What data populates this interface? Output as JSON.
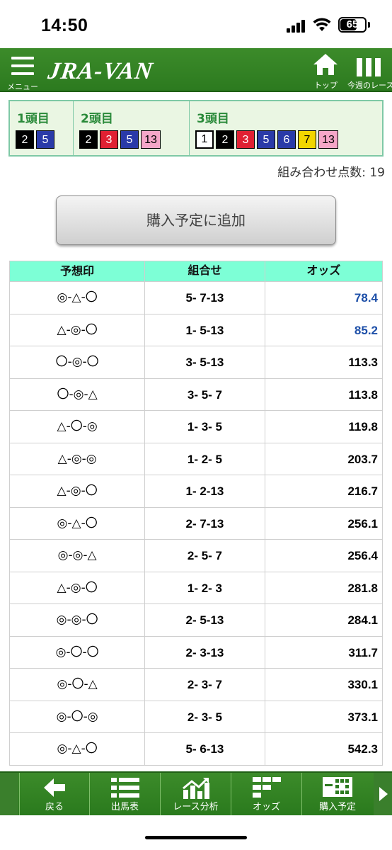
{
  "status": {
    "time": "14:50",
    "battery": "65"
  },
  "header": {
    "menu_label": "メニュー",
    "logo": "JRA-VAN",
    "top_label": "トップ",
    "week_label": "今週のレース"
  },
  "selection": {
    "cols": [
      {
        "title": "1頭目",
        "nums": [
          "2",
          "5"
        ]
      },
      {
        "title": "2頭目",
        "nums": [
          "2",
          "3",
          "5",
          "13"
        ]
      },
      {
        "title": "3頭目",
        "nums": [
          "1",
          "2",
          "3",
          "5",
          "6",
          "7",
          "13"
        ]
      }
    ]
  },
  "combo_count": "組み合わせ点数: 19",
  "add_button": "購入予定に追加",
  "table": {
    "headers": [
      "予想印",
      "組合せ",
      "オッズ"
    ],
    "rows": [
      {
        "mark": "◎-△-〇",
        "combo": "5- 7-13",
        "odds": "78.4"
      },
      {
        "mark": "△-◎-〇",
        "combo": "1- 5-13",
        "odds": "85.2"
      },
      {
        "mark": "〇-◎-〇",
        "combo": "3- 5-13",
        "odds": "113.3"
      },
      {
        "mark": "〇-◎-△",
        "combo": "3- 5- 7",
        "odds": "113.8"
      },
      {
        "mark": "△-〇-◎",
        "combo": "1- 3- 5",
        "odds": "119.8"
      },
      {
        "mark": "△-◎-◎",
        "combo": "1- 2- 5",
        "odds": "203.7"
      },
      {
        "mark": "△-◎-〇",
        "combo": "1- 2-13",
        "odds": "216.7"
      },
      {
        "mark": "◎-△-〇",
        "combo": "2- 7-13",
        "odds": "256.1"
      },
      {
        "mark": "◎-◎-△",
        "combo": "2- 5- 7",
        "odds": "256.4"
      },
      {
        "mark": "△-◎-〇",
        "combo": "1- 2- 3",
        "odds": "281.8"
      },
      {
        "mark": "◎-◎-〇",
        "combo": "2- 5-13",
        "odds": "284.1"
      },
      {
        "mark": "◎-〇-〇",
        "combo": "2- 3-13",
        "odds": "311.7"
      },
      {
        "mark": "◎-〇-△",
        "combo": "2- 3- 7",
        "odds": "330.1"
      },
      {
        "mark": "◎-〇-◎",
        "combo": "2- 3- 5",
        "odds": "373.1"
      },
      {
        "mark": "◎-△-〇",
        "combo": "5- 6-13",
        "odds": "542.3"
      }
    ]
  },
  "bottom_nav": {
    "items": [
      "戻る",
      "出馬表",
      "レース分析",
      "オッズ",
      "購入予定"
    ]
  },
  "colors": {
    "header_green": "#2c7a1f",
    "table_header": "#7dffd6",
    "odds_blue": "#1d4fa8"
  }
}
